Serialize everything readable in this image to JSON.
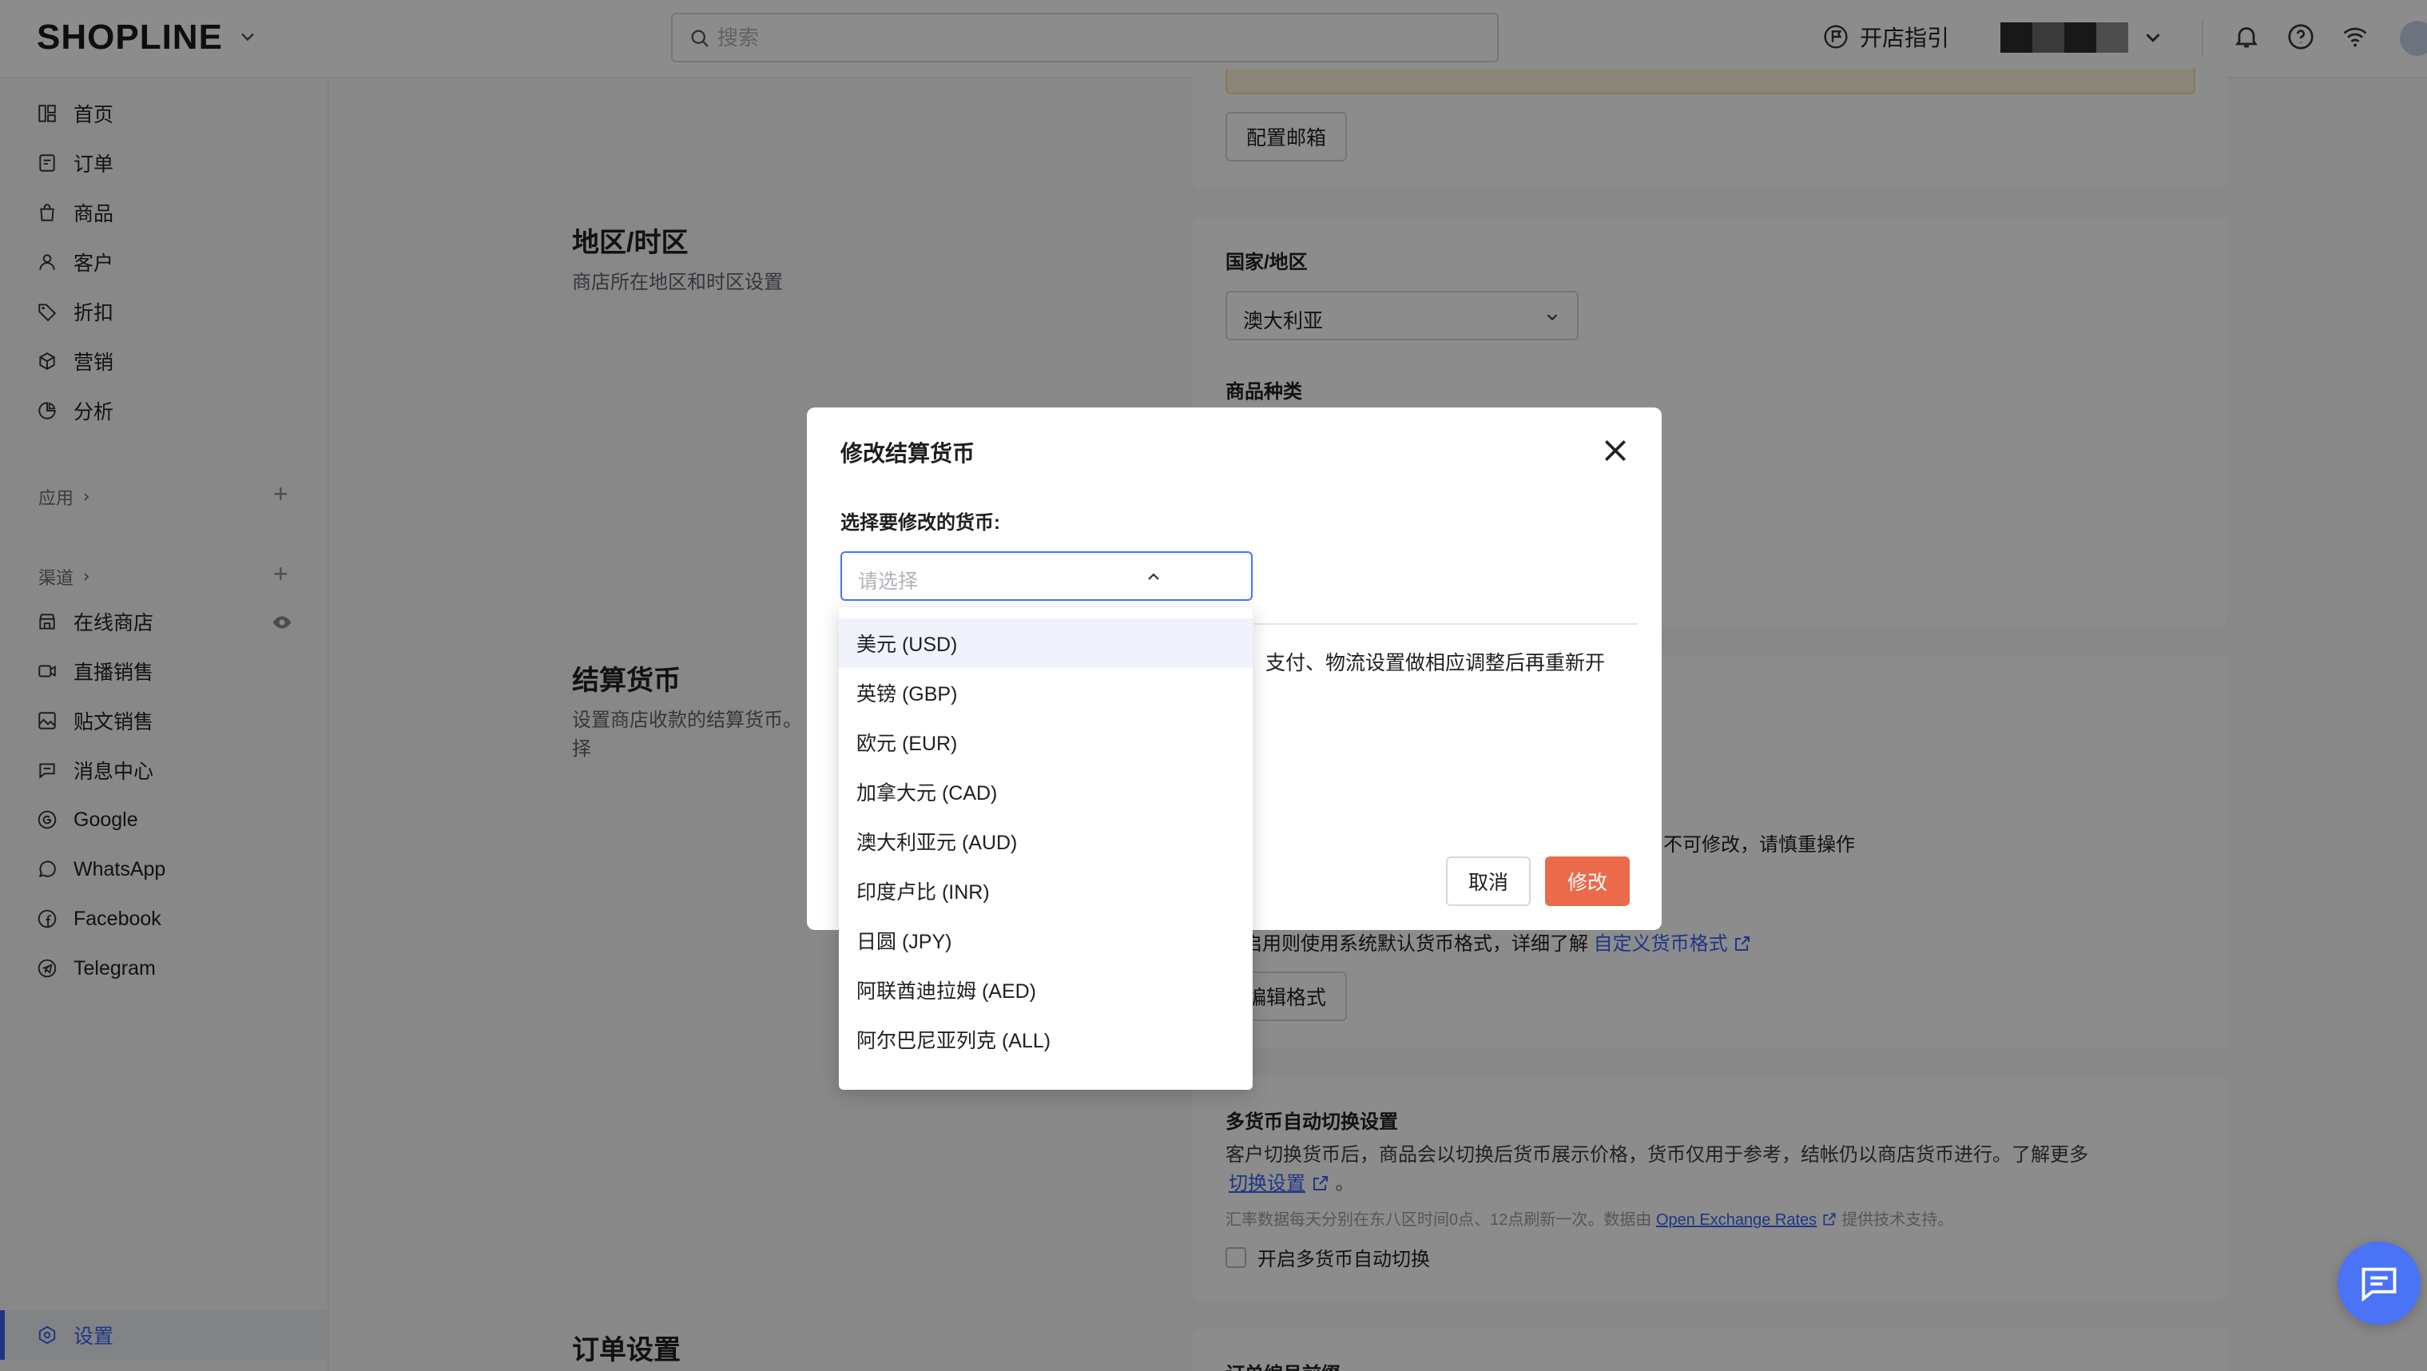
{
  "topbar": {
    "logo": "SHOPLINE",
    "search_placeholder": "搜索",
    "guide_label": "开店指引"
  },
  "sidebar": {
    "items": [
      {
        "label": "首页",
        "icon": "home-icon"
      },
      {
        "label": "订单",
        "icon": "order-icon"
      },
      {
        "label": "商品",
        "icon": "bag-icon"
      },
      {
        "label": "客户",
        "icon": "user-icon"
      },
      {
        "label": "折扣",
        "icon": "tag-icon"
      },
      {
        "label": "营销",
        "icon": "marketing-icon"
      },
      {
        "label": "分析",
        "icon": "pie-icon"
      }
    ],
    "apps_label": "应用",
    "channels_label": "渠道",
    "channels": [
      {
        "label": "在线商店",
        "icon": "store-icon"
      },
      {
        "label": "直播销售",
        "icon": "live-icon"
      },
      {
        "label": "贴文销售",
        "icon": "post-icon"
      },
      {
        "label": "消息中心",
        "icon": "message-icon"
      },
      {
        "label": "Google",
        "icon": "google-icon"
      },
      {
        "label": "WhatsApp",
        "icon": "whatsapp-icon"
      },
      {
        "label": "Facebook",
        "icon": "facebook-icon"
      },
      {
        "label": "Telegram",
        "icon": "telegram-icon"
      }
    ],
    "settings_label": "设置"
  },
  "main": {
    "email_button": "配置邮箱",
    "region": {
      "title": "地区/时区",
      "desc": "商店所在地区和时区设置",
      "country_label": "国家/地区",
      "country_value": "澳大利亚",
      "category_label": "商品种类"
    },
    "currency": {
      "title": "结算货币",
      "desc_line1": "设置商店收款的结算货币。",
      "desc_line2": "择",
      "warning_tail": "不可修改，请慎重操作",
      "format_text": "启用则使用系统默认货币格式，详细了解",
      "format_link": "自定义货币格式",
      "edit_format_button": "编辑格式"
    },
    "multi_currency": {
      "title": "多货币自动切换设置",
      "desc": "客户切换货币后，商品会以切换后货币展示价格，货币仅用于参考，结帐仍以商店货币进行。了解更多",
      "link": "切换设置",
      "period": "。",
      "rates_prefix": "汇率数据每天分别在东八区时间0点、12点刷新一次。数据由",
      "rates_link": "Open Exchange Rates",
      "rates_suffix": "提供技术支持。",
      "checkbox_label": "开启多货币自动切换"
    },
    "order": {
      "title": "订单设置",
      "prefix_label": "订单编号前缀"
    }
  },
  "modal": {
    "title": "修改结算货币",
    "select_label": "选择要修改的货币:",
    "select_placeholder": "请选择",
    "partial_text": "支付、物流设置做相应调整后再重新开",
    "cancel": "取消",
    "confirm": "修改"
  },
  "dropdown": {
    "options": [
      "美元 (USD)",
      "英镑 (GBP)",
      "欧元 (EUR)",
      "加拿大元 (CAD)",
      "澳大利亚元 (AUD)",
      "印度卢比 (INR)",
      "日圆 (JPY)",
      "阿联酋迪拉姆 (AED)",
      "阿尔巴尼亚列克 (ALL)"
    ],
    "highlighted_index": 0
  },
  "colors": {
    "accent": "#3862f5",
    "primary_button": "#ea6a4a",
    "overlay": "rgba(0,0,0,0.45)"
  }
}
